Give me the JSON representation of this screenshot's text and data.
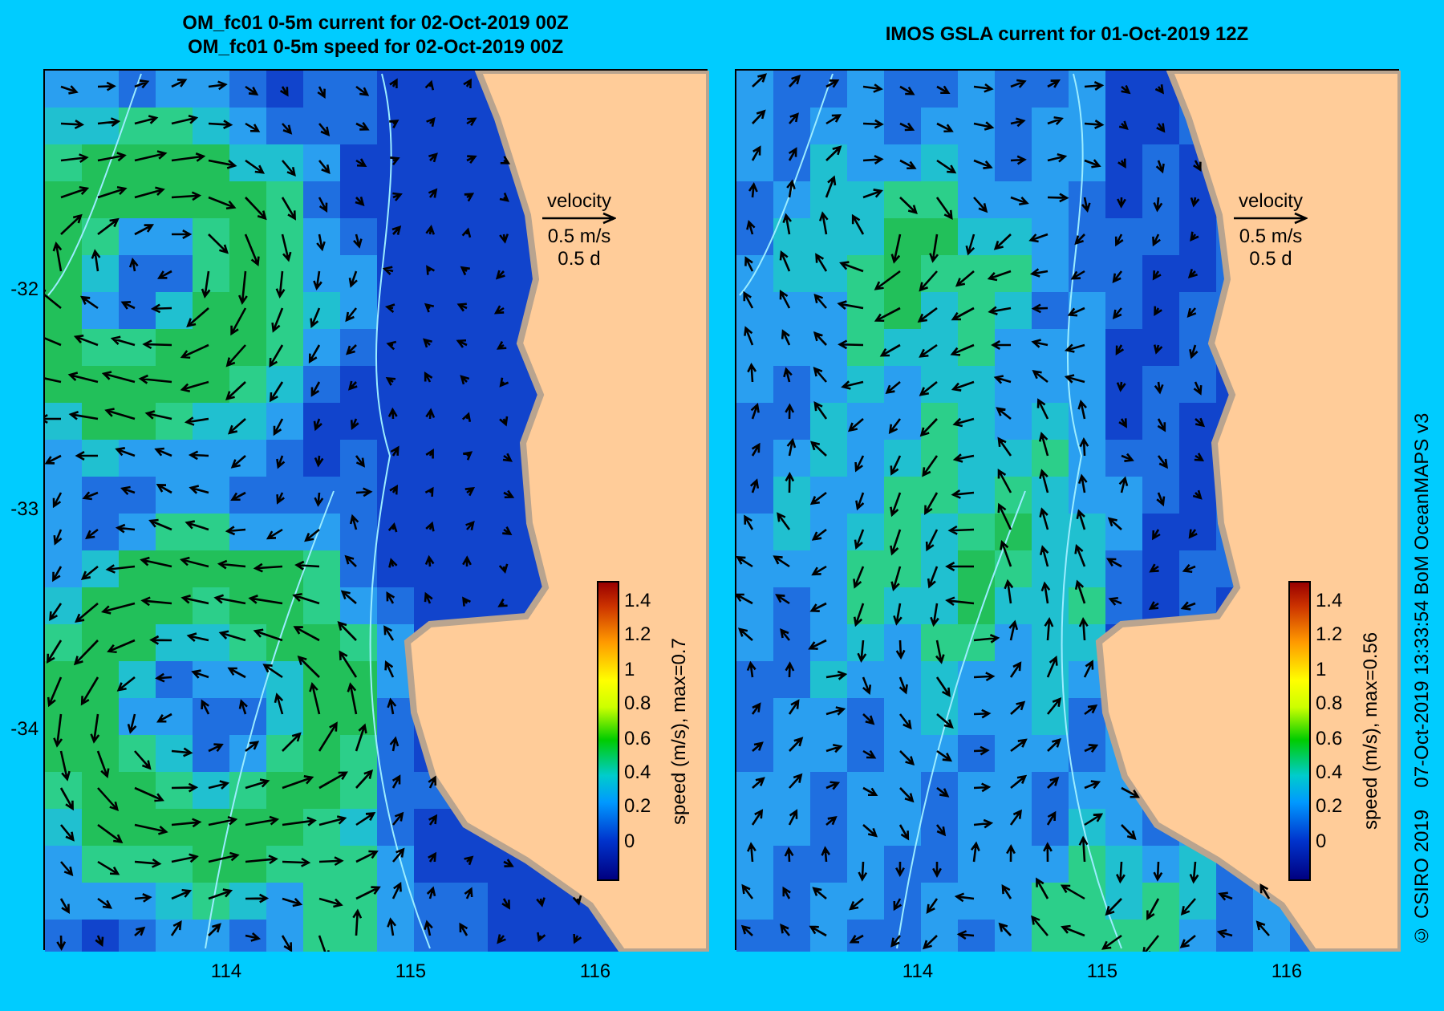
{
  "panels": [
    {
      "titles": [
        "OM_fc01 0-5m current for 02-Oct-2019 00Z",
        "OM_fc01 0-5m speed for 02-Oct-2019 00Z"
      ],
      "legend": {
        "title": "velocity",
        "scale": "0.5 m/s",
        "duration": "0.5 d"
      },
      "colorbar": {
        "label": "speed (m/s), max=0.7",
        "ticks": [
          "1.4",
          "1.2",
          "1",
          "0.8",
          "0.6",
          "0.4",
          "0.2",
          "0"
        ]
      },
      "x_ticks": [
        "114",
        "115",
        "116"
      ],
      "y_ticks": [
        "-32",
        "-33",
        "-34"
      ]
    },
    {
      "titles": [
        "IMOS GSLA current for 01-Oct-2019 12Z"
      ],
      "legend": {
        "title": "velocity",
        "scale": "0.5 m/s",
        "duration": "0.5 d"
      },
      "colorbar": {
        "label": "speed (m/s), max=0.56",
        "ticks": [
          "1.4",
          "1.2",
          "1",
          "0.8",
          "0.6",
          "0.4",
          "0.2",
          "0"
        ]
      },
      "x_ticks": [
        "114",
        "115",
        "116"
      ]
    }
  ],
  "credit": [
    "© CSIRO 2019",
    "07-Oct-2019 13:33:54 BoM OceanMAPS v3"
  ]
}
